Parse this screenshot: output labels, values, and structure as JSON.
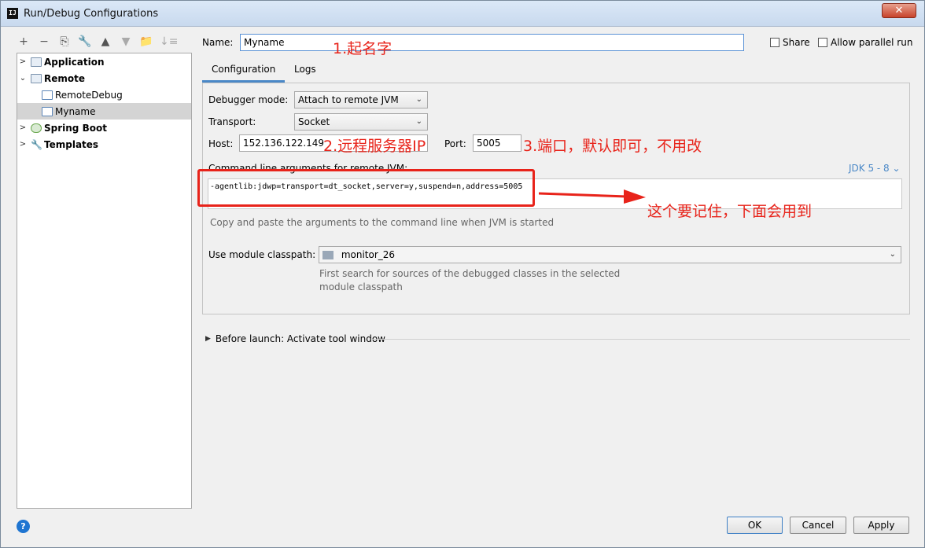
{
  "window": {
    "title": "Run/Debug Configurations",
    "close_label": "✕"
  },
  "toolbar": [
    "+",
    "−",
    "⎘",
    "🔧",
    "▲",
    "▼",
    "📁",
    "↓≡"
  ],
  "tree": [
    {
      "label": "Application",
      "arrow": ">",
      "bold": true
    },
    {
      "label": "Remote",
      "arrow": "⌄",
      "bold": true
    },
    {
      "label": "RemoteDebug",
      "arrow": "",
      "bold": false
    },
    {
      "label": "Myname",
      "arrow": "",
      "bold": false
    },
    {
      "label": "Spring Boot",
      "arrow": ">",
      "bold": true
    },
    {
      "label": "Templates",
      "arrow": ">",
      "bold": true
    }
  ],
  "form": {
    "name_label": "Name:",
    "name_value": "Myname",
    "share_label": "Share",
    "parallel_label": "Allow parallel run",
    "tabs": [
      "Configuration",
      "Logs"
    ],
    "debugger_label": "Debugger mode:",
    "debugger_value": "Attach to remote JVM",
    "transport_label": "Transport:",
    "transport_value": "Socket",
    "host_label": "Host:",
    "host_value": "152.136.122.149",
    "port_label": "Port:",
    "port_value": "5005",
    "cmd_label": "Command line arguments for remote JVM:",
    "jdk_label": "JDK 5 - 8",
    "cmd_value": "-agentlib:jdwp=transport=dt_socket,server=y,suspend=n,address=5005",
    "cmd_hint": "Copy and paste the arguments to the command line when JVM is started",
    "module_label": "Use module classpath:",
    "module_value": "monitor_26",
    "module_hint_1": "First search for sources of the debugged classes in the selected",
    "module_hint_2": "module classpath",
    "before_launch": "Before launch: Activate tool window"
  },
  "annotations": {
    "name_note": "1.起名字",
    "host_note": "2.远程服务器IP",
    "port_note": "3.端口，默认即可，不用改",
    "cmd_note": "这个要记住，下面会用到"
  },
  "buttons": {
    "ok": "OK",
    "cancel": "Cancel",
    "apply": "Apply",
    "help": "?"
  },
  "colors": {
    "annotation": "#e8231a",
    "accent": "#4a88c7"
  }
}
